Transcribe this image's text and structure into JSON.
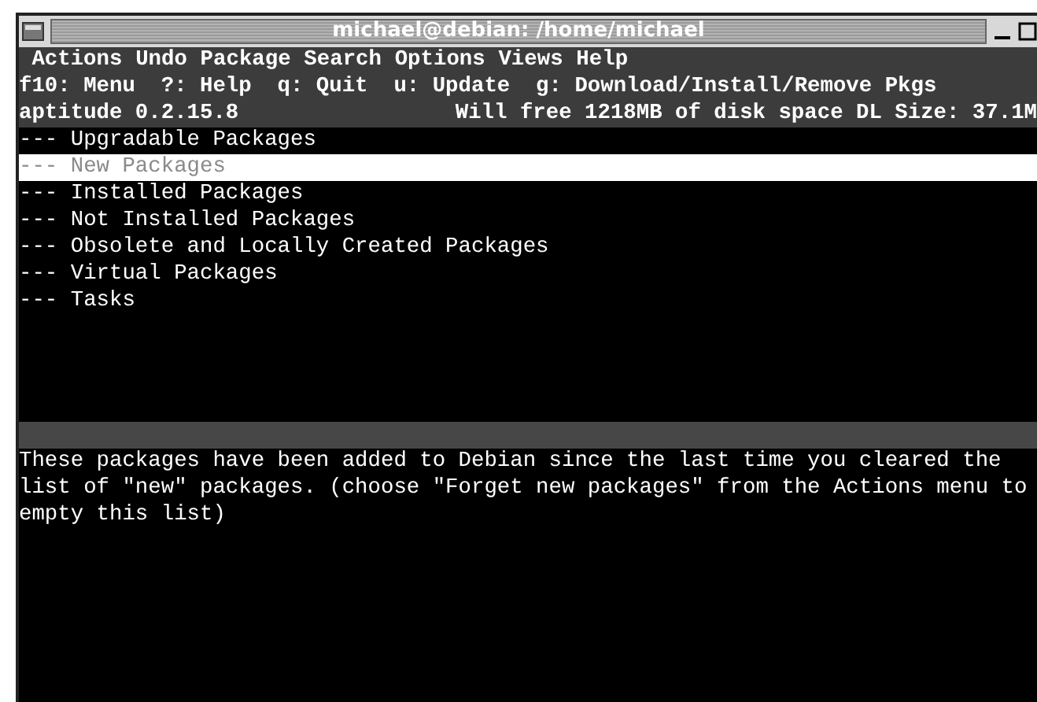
{
  "window": {
    "title": "michael@debian: /home/michael"
  },
  "menu": [
    "Actions",
    "Undo",
    "Package",
    "Search",
    "Options",
    "Views",
    "Help"
  ],
  "help_line": "f10: Menu  ?: Help  q: Quit  u: Update  g: Download/Install/Remove Pkgs",
  "status_bar": {
    "left": "aptitude 0.2.15.8",
    "right": "Will free 1218MB of disk space DL Size: 37.1M"
  },
  "categories": [
    {
      "label": "--- Upgradable Packages",
      "selected": false
    },
    {
      "label": "--- New Packages",
      "selected": true
    },
    {
      "label": "--- Installed Packages",
      "selected": false
    },
    {
      "label": "--- Not Installed Packages",
      "selected": false
    },
    {
      "label": "--- Obsolete and Locally Created Packages",
      "selected": false
    },
    {
      "label": "--- Virtual Packages",
      "selected": false
    },
    {
      "label": "--- Tasks",
      "selected": false
    }
  ],
  "description": "These packages have been added to Debian since the last time you cleared the list of \"new\" packages. (choose \"Forget new packages\" from the Actions menu to empty this list)"
}
